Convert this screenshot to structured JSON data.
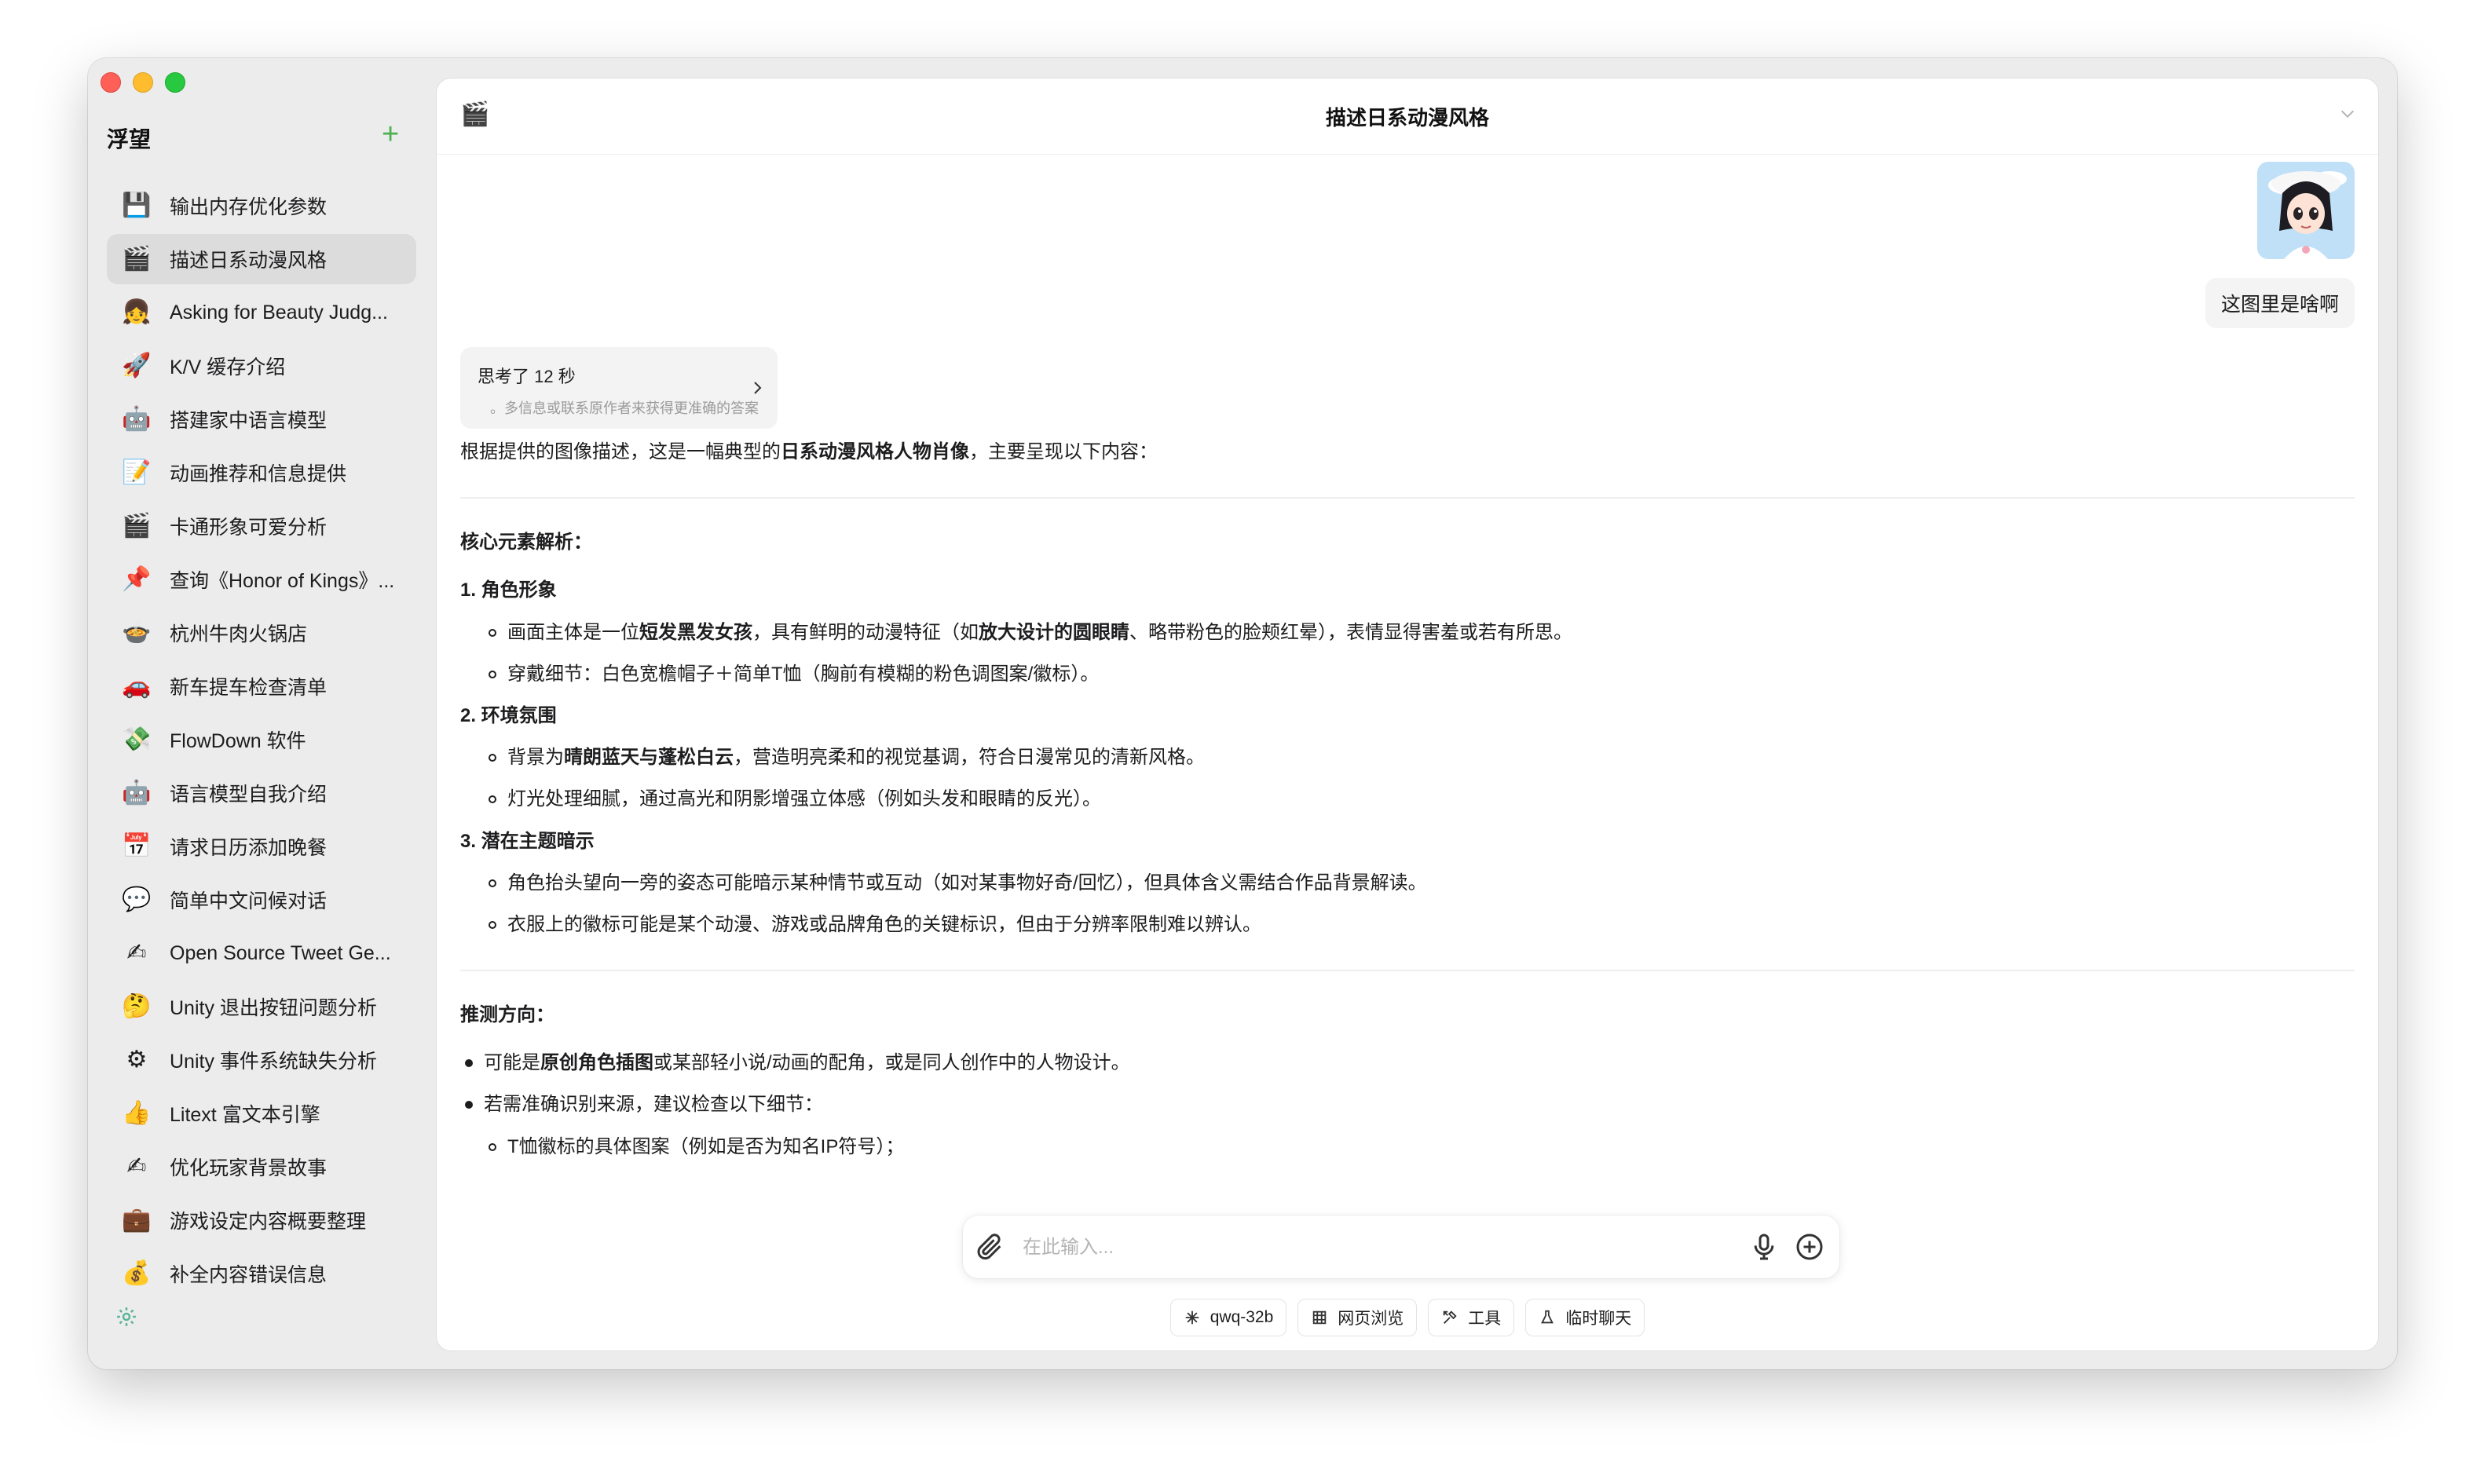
{
  "sidebar": {
    "title": "浮望",
    "add_symbol": "+",
    "items": [
      {
        "emoji": "💾",
        "label": "输出内存优化参数"
      },
      {
        "emoji": "🎬",
        "label": "描述日系动漫风格"
      },
      {
        "emoji": "👧",
        "label": "Asking for Beauty Judg..."
      },
      {
        "emoji": "🚀",
        "label": "K/V 缓存介绍"
      },
      {
        "emoji": "🤖",
        "label": "搭建家中语言模型"
      },
      {
        "emoji": "📝",
        "label": "动画推荐和信息提供"
      },
      {
        "emoji": "🎬",
        "label": "卡通形象可爱分析"
      },
      {
        "emoji": "📌",
        "label": "查询《Honor of Kings》..."
      },
      {
        "emoji": "🍲",
        "label": "杭州牛肉火锅店"
      },
      {
        "emoji": "🚗",
        "label": "新车提车检查清单"
      },
      {
        "emoji": "💸",
        "label": "FlowDown 软件"
      },
      {
        "emoji": "🤖",
        "label": "语言模型自我介绍"
      },
      {
        "emoji": "📅",
        "label": "请求日历添加晚餐"
      },
      {
        "emoji": "💬",
        "label": "简单中文问候对话"
      },
      {
        "emoji": "✍",
        "label": "Open Source Tweet Ge..."
      },
      {
        "emoji": "🤔",
        "label": "Unity 退出按钮问题分析"
      },
      {
        "emoji": "⚙",
        "label": "Unity 事件系统缺失分析"
      },
      {
        "emoji": "👍",
        "label": "Litext 富文本引擎"
      },
      {
        "emoji": "✍",
        "label": "优化玩家背景故事"
      },
      {
        "emoji": "💼",
        "label": "游戏设定内容概要整理"
      },
      {
        "emoji": "💰",
        "label": "补全内容错误信息"
      }
    ]
  },
  "header": {
    "icon": "🎬",
    "title": "描述日系动漫风格"
  },
  "chat": {
    "user_message": "这图里是啥啊",
    "thinking": {
      "title": "思考了 12 秒",
      "subtitle": "多信息或联系原作者来获得更准确的答案。"
    },
    "answer": {
      "intro_a": "根据提供的图像描述，这是一幅典型的",
      "intro_b": "日系动漫风格人物肖像",
      "intro_c": "，主要呈现以下内容：",
      "section1_title": "核心元素解析：",
      "n1_title": "1. 角色形象",
      "n1_b1_a": "画面主体是一位",
      "n1_b1_b": "短发黑发女孩",
      "n1_b1_c": "，具有鲜明的动漫特征（如",
      "n1_b1_d": "放大设计的圆眼睛",
      "n1_b1_e": "、略带粉色的脸颊红晕），表情显得害羞或若有所思。",
      "n1_b2": "穿戴细节：白色宽檐帽子＋简单T恤（胸前有模糊的粉色调图案/徽标）。",
      "n2_title": "2. 环境氛围",
      "n2_b1_a": "背景为",
      "n2_b1_b": "晴朗蓝天与蓬松白云",
      "n2_b1_c": "，营造明亮柔和的视觉基调，符合日漫常见的清新风格。",
      "n2_b2": "灯光处理细腻，通过高光和阴影增强立体感（例如头发和眼睛的反光）。",
      "n3_title": "3. 潜在主题暗示",
      "n3_b1": "角色抬头望向一旁的姿态可能暗示某种情节或互动（如对某事物好奇/回忆），但具体含义需结合作品背景解读。",
      "n3_b2": "衣服上的徽标可能是某个动漫、游戏或品牌角色的关键标识，但由于分辨率限制难以辨认。",
      "section2_title": "推测方向：",
      "d1_a": "可能是",
      "d1_b": "原创角色插图",
      "d1_c": "或某部轻小说/动画的配角，或是同人创作中的人物设计。",
      "d2": "若需准确识别来源，建议检查以下细节：",
      "d2_s1": "T恤徽标的具体图案（例如是否为知名IP符号）；"
    }
  },
  "input": {
    "placeholder": "在此输入..."
  },
  "chips": [
    {
      "icon": "sparkle-icon",
      "label": "qwq-32b"
    },
    {
      "icon": "web-icon",
      "label": "网页浏览"
    },
    {
      "icon": "tools-icon",
      "label": "工具"
    },
    {
      "icon": "flask-icon",
      "label": "临时聊天"
    }
  ],
  "colors": {
    "accent_green": "#4caf50",
    "sidebar_bg": "#ececec",
    "active_item_bg": "#dcdcdc"
  }
}
